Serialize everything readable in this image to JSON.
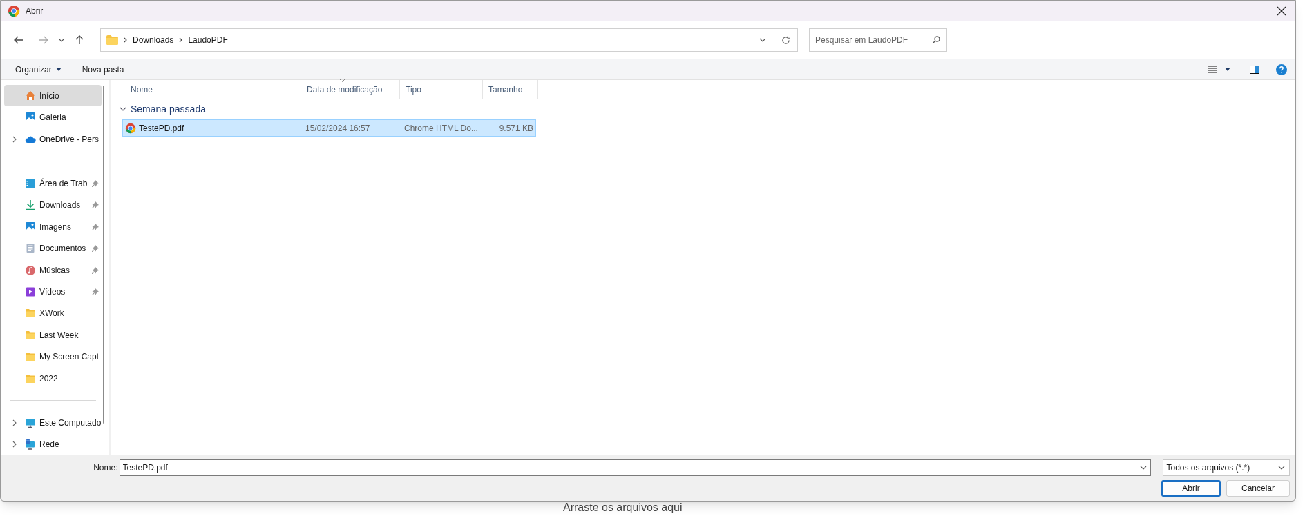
{
  "window": {
    "title": "Abrir"
  },
  "address": {
    "breadcrumbs": [
      "Downloads",
      "LaudoPDF"
    ]
  },
  "search": {
    "placeholder": "Pesquisar em LaudoPDF"
  },
  "toolbar": {
    "organize": "Organizar",
    "new_folder": "Nova pasta"
  },
  "sidebar": {
    "groups": [
      [
        {
          "label": "Início",
          "kind": "home",
          "selected": true,
          "expandable": false,
          "pinned": false
        },
        {
          "label": "Galeria",
          "kind": "gallery",
          "selected": false,
          "expandable": false,
          "pinned": false
        },
        {
          "label": "OneDrive - Pers",
          "kind": "cloud",
          "selected": false,
          "expandable": true,
          "pinned": false
        }
      ],
      [
        {
          "label": "Área de Trab",
          "kind": "desktop",
          "selected": false,
          "expandable": false,
          "pinned": true
        },
        {
          "label": "Downloads",
          "kind": "download",
          "selected": false,
          "expandable": false,
          "pinned": true
        },
        {
          "label": "Imagens",
          "kind": "pictures",
          "selected": false,
          "expandable": false,
          "pinned": true
        },
        {
          "label": "Documentos",
          "kind": "documents",
          "selected": false,
          "expandable": false,
          "pinned": true
        },
        {
          "label": "Músicas",
          "kind": "music",
          "selected": false,
          "expandable": false,
          "pinned": true
        },
        {
          "label": "Vídeos",
          "kind": "videos",
          "selected": false,
          "expandable": false,
          "pinned": true
        },
        {
          "label": "XWork",
          "kind": "folder",
          "selected": false,
          "expandable": false,
          "pinned": false
        },
        {
          "label": "Last Week",
          "kind": "folder",
          "selected": false,
          "expandable": false,
          "pinned": false
        },
        {
          "label": "My Screen Capt",
          "kind": "folder",
          "selected": false,
          "expandable": false,
          "pinned": false
        },
        {
          "label": "2022",
          "kind": "folder",
          "selected": false,
          "expandable": false,
          "pinned": false
        }
      ],
      [
        {
          "label": "Este Computado",
          "kind": "computer",
          "selected": false,
          "expandable": true,
          "pinned": false
        },
        {
          "label": "Rede",
          "kind": "network",
          "selected": false,
          "expandable": true,
          "pinned": false
        }
      ]
    ]
  },
  "columns": [
    {
      "label": "Nome",
      "sorted": false
    },
    {
      "label": "Data de modificação",
      "sorted": true
    },
    {
      "label": "Tipo",
      "sorted": false
    },
    {
      "label": "Tamanho",
      "sorted": false
    }
  ],
  "groups": [
    {
      "label": "Semana passada",
      "expanded": true,
      "files": [
        {
          "name": "TestePD.pdf",
          "modified": "15/02/2024 16:57",
          "type": "Chrome HTML Do...",
          "size": "9.571 KB",
          "selected": true
        }
      ]
    }
  ],
  "footer": {
    "name_label": "Nome:",
    "name_value": "TestePD.pdf",
    "filter": "Todos os arquivos (*.*)",
    "buttons": [
      {
        "label": "Abrir",
        "default": true
      },
      {
        "label": "Cancelar",
        "default": false
      }
    ]
  },
  "background_text": "Arraste os arquivos aqui"
}
